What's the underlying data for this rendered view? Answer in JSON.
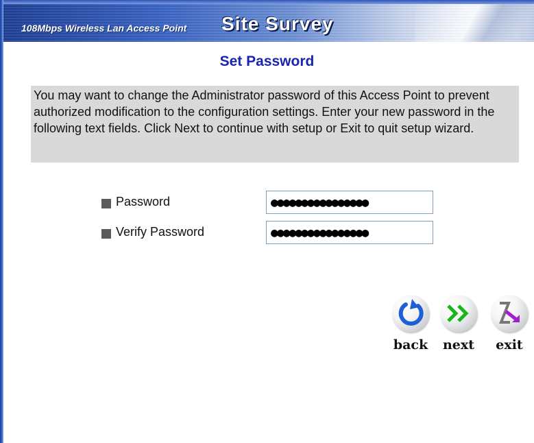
{
  "header": {
    "subtitle": "108Mbps Wireless Lan Access Point",
    "title": "Site Survey"
  },
  "page_title": "Set Password",
  "description": "You may want to change the Administrator password of this Access Point to prevent authorized modification to the configuration settings. Enter your new password in the following text fields. Click Next to continue with setup or Exit to quit setup wizard.",
  "form": {
    "password": {
      "label": "Password",
      "value": "●●●●●●●●●●●●●●●●"
    },
    "verify_password": {
      "label": "Verify Password",
      "value": "●●●●●●●●●●●●●●●●"
    }
  },
  "nav": {
    "back": {
      "label": "back",
      "icon": "back-arrow-icon",
      "color": "#1e5fd8"
    },
    "next": {
      "label": "next",
      "icon": "double-chevron-right-icon",
      "color": "#19b61a"
    },
    "exit": {
      "label": "exit",
      "icon": "exit-door-icon",
      "color": "#a020d0"
    }
  }
}
